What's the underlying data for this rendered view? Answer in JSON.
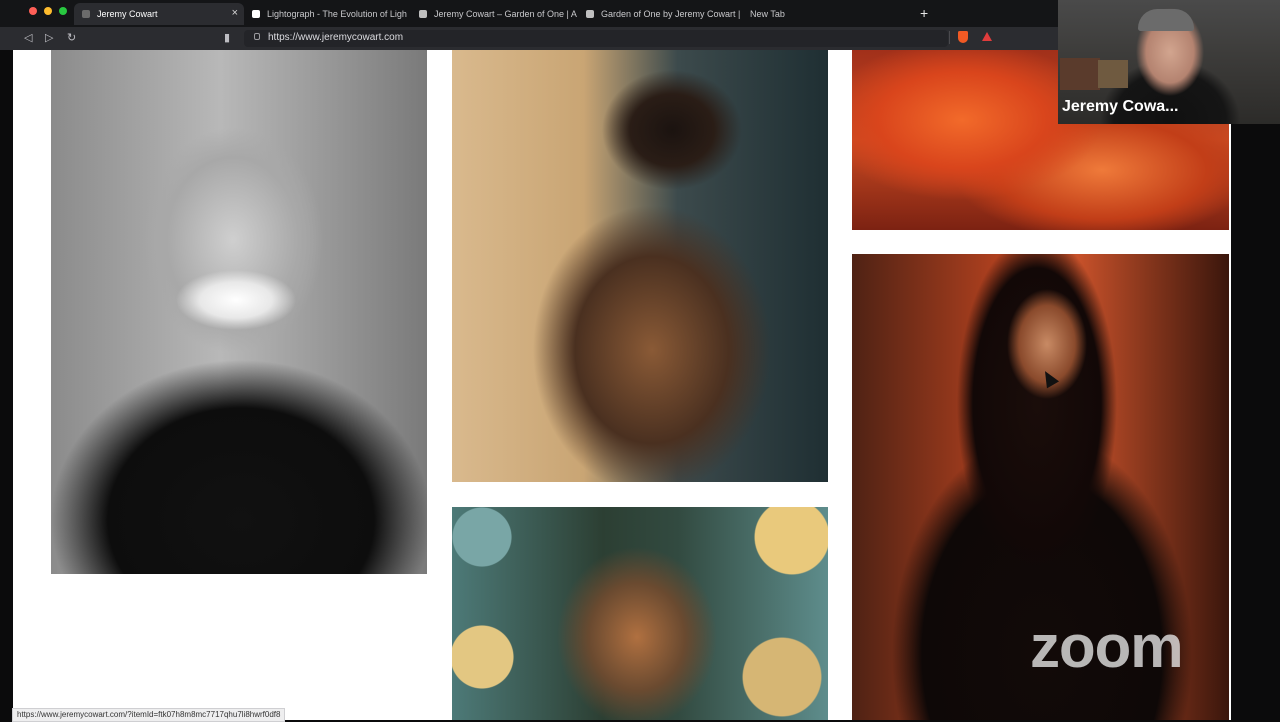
{
  "browser": {
    "tabs": [
      {
        "label": "Jeremy Cowart",
        "active": true,
        "favicon_color": "#6b6b6b"
      },
      {
        "label": "Lightograph - The Evolution of Ligh",
        "favicon_color": "#ffffff",
        "favicon_glyph": "L"
      },
      {
        "label": "Jeremy Cowart – Garden of One | A",
        "favicon_color": "#bfbfbf"
      },
      {
        "label": "Garden of One by Jeremy Cowart |",
        "favicon_color": "#bfbfbf"
      },
      {
        "label": "New Tab"
      }
    ],
    "new_tab_symbol": "+",
    "close_tab_symbol": "×",
    "nav": {
      "back_icon": "◁",
      "forward_icon": "▷",
      "reload_icon": "↻",
      "bookmark_icon": "▮"
    },
    "url": "https://www.jeremycowart.com",
    "extensions": [
      "brave-shield-icon",
      "brave-rewards-icon"
    ]
  },
  "gallery": {
    "photos": [
      {
        "name": "photo-laughing-man",
        "description": "black and white portrait"
      },
      {
        "name": "photo-split-tone-man"
      },
      {
        "name": "photo-woman-with-circles"
      },
      {
        "name": "photo-orange-fabric"
      },
      {
        "name": "photo-woman-red-smoke"
      }
    ]
  },
  "video": {
    "participant_name": "Jeremy Cowa...",
    "watermark": "zoom"
  },
  "status_bar": {
    "link": "https://www.jeremycowart.com/?itemId=ftk07h8m8mc7717qhu7li8hwrf0df8"
  },
  "colors": {
    "chrome_bg": "#1f2023",
    "tab_active_bg": "#2b2c30",
    "page_bg": "#ffffff",
    "accent_brave": "#f15a24"
  }
}
